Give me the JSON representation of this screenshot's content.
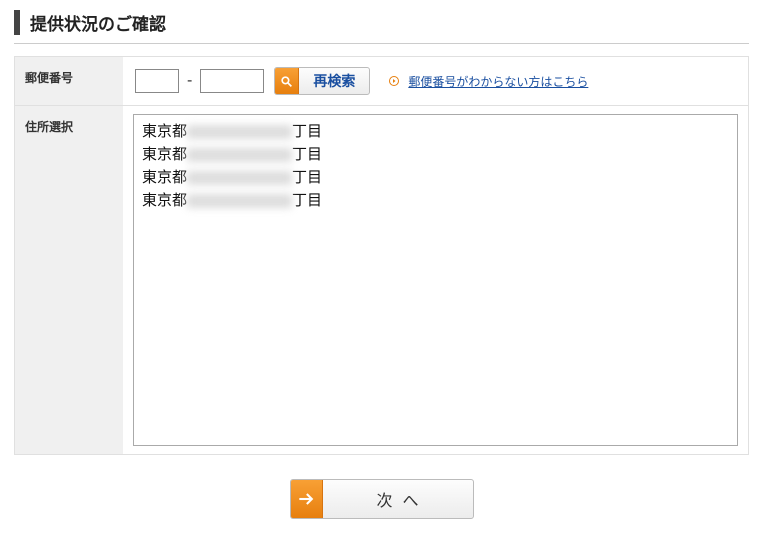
{
  "page_title": "提供状況のご確認",
  "postal": {
    "label": "郵便番号",
    "part1": "",
    "part2": "",
    "separator": "-",
    "research_button": "再検索",
    "help_link": "郵便番号がわからない方はこちら"
  },
  "address": {
    "label": "住所選択",
    "items": [
      {
        "prefix": "東京都",
        "masked": "　　　　　　　",
        "suffix": "丁目"
      },
      {
        "prefix": "東京都",
        "masked": "　　　　　　　",
        "suffix": "丁目"
      },
      {
        "prefix": "東京都",
        "masked": "　　　　　　　",
        "suffix": "丁目"
      },
      {
        "prefix": "東京都",
        "masked": "　　　　　　　",
        "suffix": "丁目"
      }
    ]
  },
  "next_button": "次へ"
}
